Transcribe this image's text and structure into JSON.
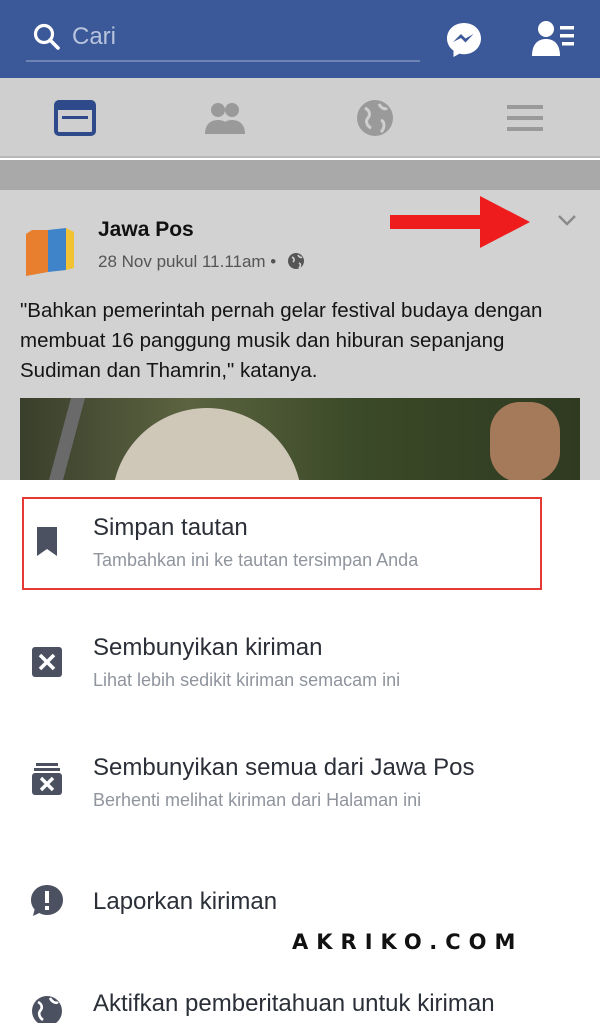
{
  "search": {
    "placeholder": "Cari"
  },
  "tabs": [
    "news-feed",
    "friends",
    "notifications",
    "menu"
  ],
  "post": {
    "author": "Jawa Pos",
    "meta": "28 Nov pukul 11.11am •",
    "text": "\"Bahkan pemerintah pernah gelar festival budaya dengan membuat 16 panggung musik dan hiburan sepanjang Sudiman dan Thamrin,\" katanya."
  },
  "menu": {
    "items": [
      {
        "title": "Simpan tautan",
        "subtitle": "Tambahkan ini ke tautan tersimpan Anda",
        "icon": "bookmark-icon"
      },
      {
        "title": "Sembunyikan kiriman",
        "subtitle": "Lihat lebih sedikit kiriman semacam ini",
        "icon": "hide-icon"
      },
      {
        "title": "Sembunyikan semua dari Jawa Pos",
        "subtitle": "Berhenti melihat kiriman dari Halaman ini",
        "icon": "hide-all-icon"
      },
      {
        "title": "Laporkan kiriman",
        "subtitle": "",
        "icon": "report-icon"
      },
      {
        "title": "Aktifkan pemberitahuan untuk kiriman",
        "subtitle": "",
        "icon": "globe-icon"
      }
    ]
  },
  "watermark": "AKRIKO.COM",
  "colors": {
    "brand_blue": "#3b5998",
    "highlight_red": "#e53935",
    "arrow_red": "#ee1c1c"
  }
}
